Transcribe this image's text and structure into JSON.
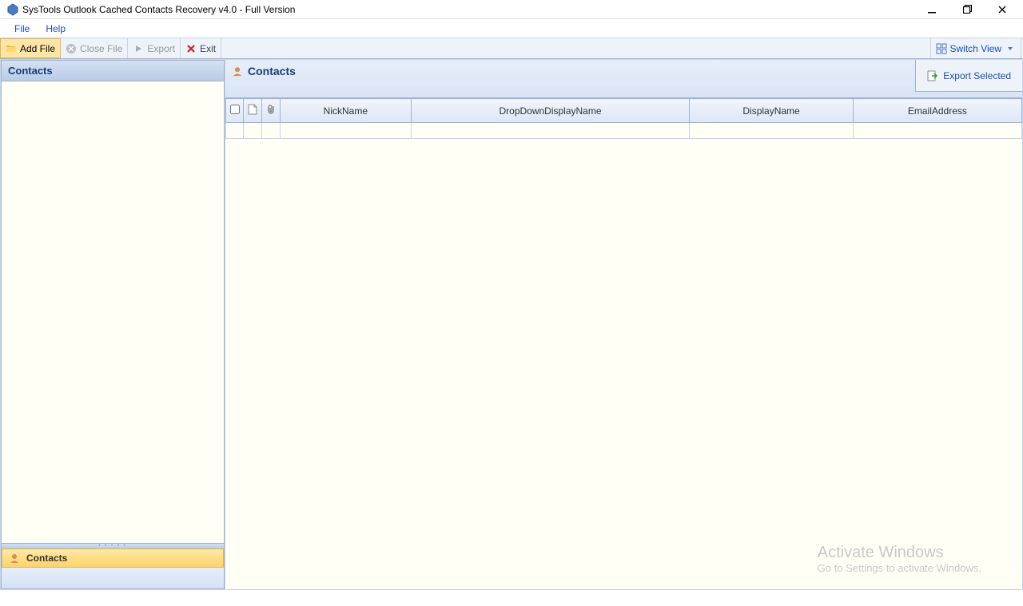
{
  "window": {
    "title": "SysTools Outlook Cached Contacts Recovery v4.0  - Full Version"
  },
  "menu": {
    "file": "File",
    "help": "Help"
  },
  "toolbar": {
    "add_file": "Add File",
    "close_file": "Close File",
    "export": "Export",
    "exit": "Exit",
    "switch_view": "Switch View"
  },
  "sidebar": {
    "header": "Contacts",
    "tab_label": "Contacts"
  },
  "content": {
    "title": "Contacts",
    "export_selected": "Export Selected"
  },
  "table": {
    "columns": {
      "nickname": "NickName",
      "dropdown": "DropDownDisplayName",
      "display": "DisplayName",
      "email": "EmailAddress"
    }
  },
  "watermark": {
    "line1": "Activate Windows",
    "line2": "Go to Settings to activate Windows."
  }
}
